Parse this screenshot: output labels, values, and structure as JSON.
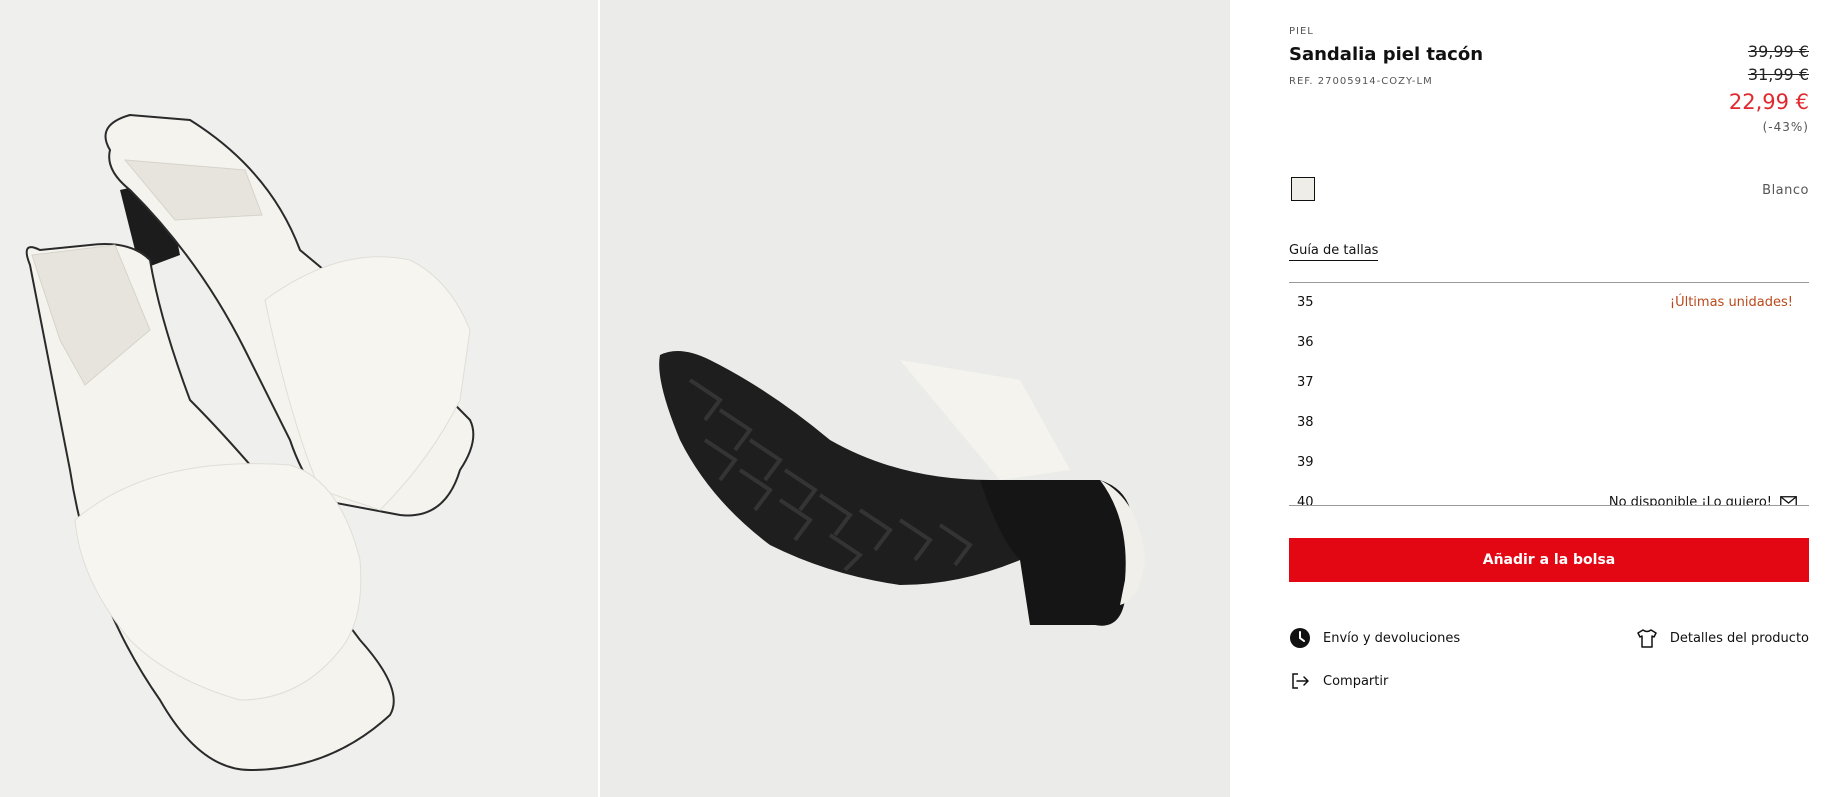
{
  "product": {
    "category": "PIEL",
    "name": "Sandalia piel tacón",
    "reference": "REF. 27005914-COZY-LM"
  },
  "pricing": {
    "original_price": "39,99 €",
    "previous_price": "31,99 €",
    "current_price": "22,99 €",
    "discount": "(-43%)",
    "sale_color": "#e0282e"
  },
  "color": {
    "name": "Blanco",
    "swatch": "#efede8"
  },
  "size_guide_label": "Guía de tallas",
  "sizes": [
    {
      "size": "35",
      "note": "¡Últimas unidades!"
    },
    {
      "size": "36",
      "note": ""
    },
    {
      "size": "37",
      "note": ""
    },
    {
      "size": "38",
      "note": ""
    },
    {
      "size": "39",
      "note": ""
    },
    {
      "size": "40",
      "note": "No disponible ¡Lo quiero!",
      "icon": "mail-icon"
    }
  ],
  "actions": {
    "add_to_bag": "Añadir a la bolsa",
    "shipping_returns": "Envío y devoluciones",
    "product_details": "Detalles del producto",
    "share": "Compartir"
  },
  "icons": {
    "shipping": "clock-icon",
    "details": "tshirt-icon",
    "share": "share-exit-icon",
    "unavailable": "mail-icon"
  },
  "brand_color": "#e30613"
}
